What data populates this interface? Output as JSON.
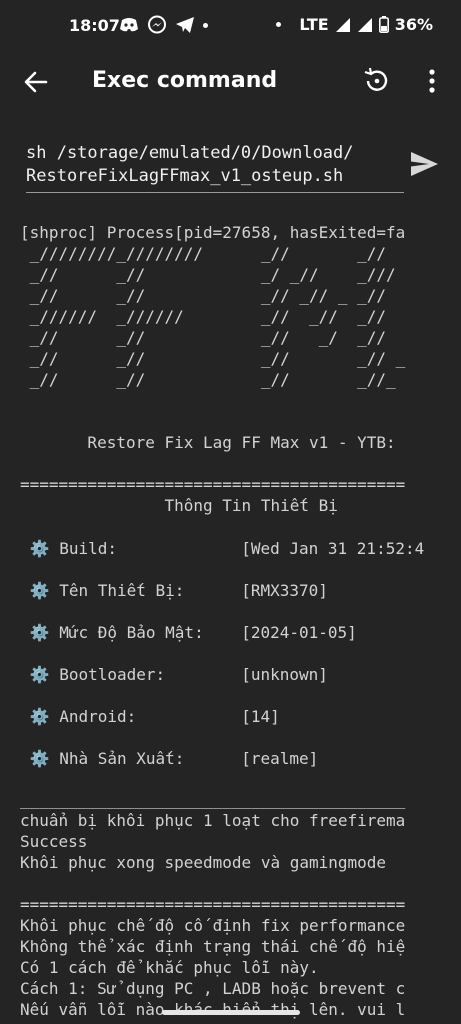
{
  "status_bar": {
    "time": "18:07",
    "network": "LTE",
    "battery": "36%"
  },
  "app_bar": {
    "title": "Exec command"
  },
  "command": {
    "line1": "sh /storage/emulated/0/Download/",
    "line2": "RestoreFixLagFFmax_v1_osteup.sh"
  },
  "output": {
    "process": "[shproc] Process[pid=27658, hasExited=fa",
    "ascii_art": [
      " _////////_////////      _//       _//",
      " _//      _//            _/ _//    _///",
      " _//      _//            _// _// _ _//",
      " _//////  _//////        _//  _//  _//",
      " _//      _//            _//   _/  _//",
      " _//      _//            _//       _// _",
      " _//      _//            _//       _//_"
    ],
    "banner": "       Restore Fix Lag FF Max v1 - YTB:",
    "separator": "========================================",
    "info_title": "               Thông Tin Thiết Bị",
    "device_info": [
      {
        "label": "Build:",
        "value": "[Wed Jan 31 21:52:4"
      },
      {
        "label": "Tên Thiết Bị:",
        "value": "[RMX3370]"
      },
      {
        "label": "Mức Độ Bảo Mật:",
        "value": "[2024-01-05]"
      },
      {
        "label": "Bootloader:",
        "value": "[unknown]"
      },
      {
        "label": "Android:",
        "value": "[14]"
      },
      {
        "label": "Nhà Sản Xuất:",
        "value": "[realme]"
      }
    ],
    "underline": "________________________________________",
    "restore_lines": [
      "chuẩn bị khôi phục 1 loạt cho freefirema",
      "Success",
      "Khôi phục xong speedmode và gamingmode"
    ],
    "separator2": "========================================",
    "fix_lines": [
      "Khôi phục chế độ cố định fix performance",
      "Không thể xác định trạng thái chế độ hiệ",
      "Có 1 cách để khắc phục lỗi này.",
      "Cách 1: Sử dụng PC , LADB hoặc brevent c",
      "Nếu vẫn lỗi nào khác hiển thị lên. vui l"
    ]
  }
}
